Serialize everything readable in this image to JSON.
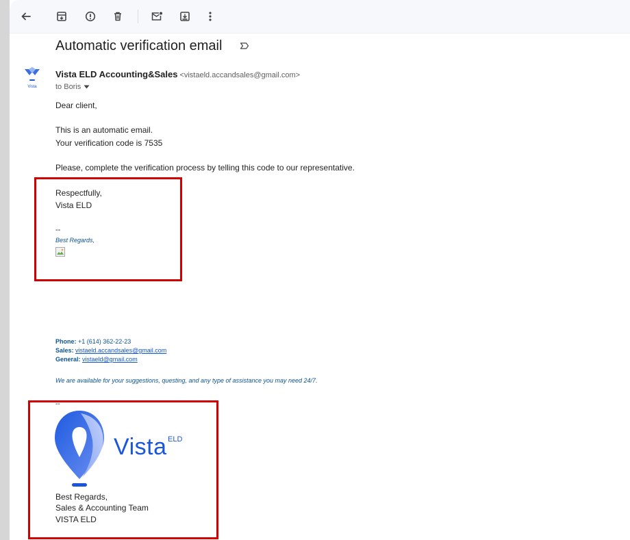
{
  "toolbar": {
    "back_icon": "arrow-back-icon",
    "archive_icon": "archive-icon",
    "report_icon": "report-spam-icon",
    "delete_icon": "trash-icon",
    "mark_unread_icon": "mark-unread-icon",
    "move_to_icon": "move-to-icon",
    "more_icon": "more-vert-icon"
  },
  "email": {
    "subject": "Automatic verification email",
    "sender_name": "Vista ELD Accounting&Sales",
    "sender_email": "<vistaeld.accandsales@gmail.com>",
    "to_line": "to Boris",
    "avatar_caption": "Vista",
    "body": {
      "greeting": "Dear client,",
      "line1": "This is an automatic email.",
      "line2": "Your verification code is 7535",
      "line3": "Please, complete the verification process by telling this code to our representative.",
      "sign1": "Respectfully,",
      "sign2": "Vista ELD",
      "dashes1": "--",
      "best_regards_italic": "Best Regards,"
    },
    "signature": {
      "phone_label": "Phone:",
      "phone_value": " +1 (614) 362-22-23",
      "sales_label": "Sales:",
      "sales_value": "vistaeld.accandsales@gmail.com",
      "general_label": "General:",
      "general_value": "vistaeld@gmail.com",
      "availability": "We are available for your suggestions, questing, and any type of assistance you may need 24/7.",
      "dashes2": "--",
      "logo_word": "Vista",
      "logo_sup": "ELD",
      "closing1": "Best Regards,",
      "closing2": "Sales & Accounting Team",
      "closing3": "VISTA ELD"
    }
  },
  "colors": {
    "highlight_box": "#d00000",
    "brand_blue": "#1a56db",
    "link": "#1155cc"
  }
}
